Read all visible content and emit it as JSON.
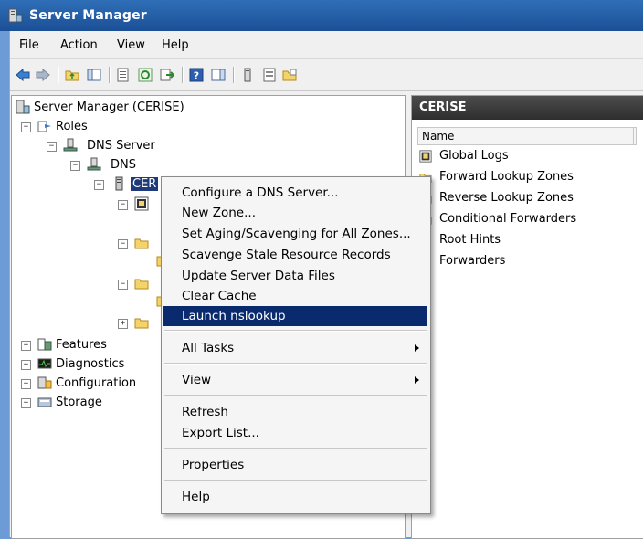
{
  "window": {
    "title": "Server Manager"
  },
  "menubar": {
    "items": [
      "File",
      "Action",
      "View",
      "Help"
    ]
  },
  "tree": {
    "root": "Server Manager (CERISE)",
    "roles": "Roles",
    "dns_server": "DNS Server",
    "dns": "DNS",
    "cerise_partial": "CER",
    "features": "Features",
    "diagnostics": "Diagnostics",
    "configuration": "Configuration",
    "storage": "Storage"
  },
  "right_pane": {
    "header": "CERISE",
    "column_name": "Name",
    "items": [
      "Global Logs",
      "Forward Lookup Zones",
      "Reverse Lookup Zones",
      "Conditional Forwarders",
      "Root Hints",
      "Forwarders"
    ]
  },
  "context_menu": {
    "items": [
      "Configure a DNS Server...",
      "New Zone...",
      "Set Aging/Scavenging for All Zones...",
      "Scavenge Stale Resource Records",
      "Update Server Data Files",
      "Clear Cache",
      "Launch nslookup",
      "All Tasks",
      "View",
      "Refresh",
      "Export List...",
      "Properties",
      "Help"
    ],
    "highlighted": "Launch nslookup"
  },
  "icons": [
    "server-manager-icon",
    "back-icon",
    "forward-icon",
    "up-folder-icon",
    "show-hide-tree-icon",
    "properties-icon",
    "refresh-icon",
    "export-icon",
    "help-icon",
    "action-pane-icon",
    "server-icon",
    "list-icon",
    "folder-icon"
  ]
}
